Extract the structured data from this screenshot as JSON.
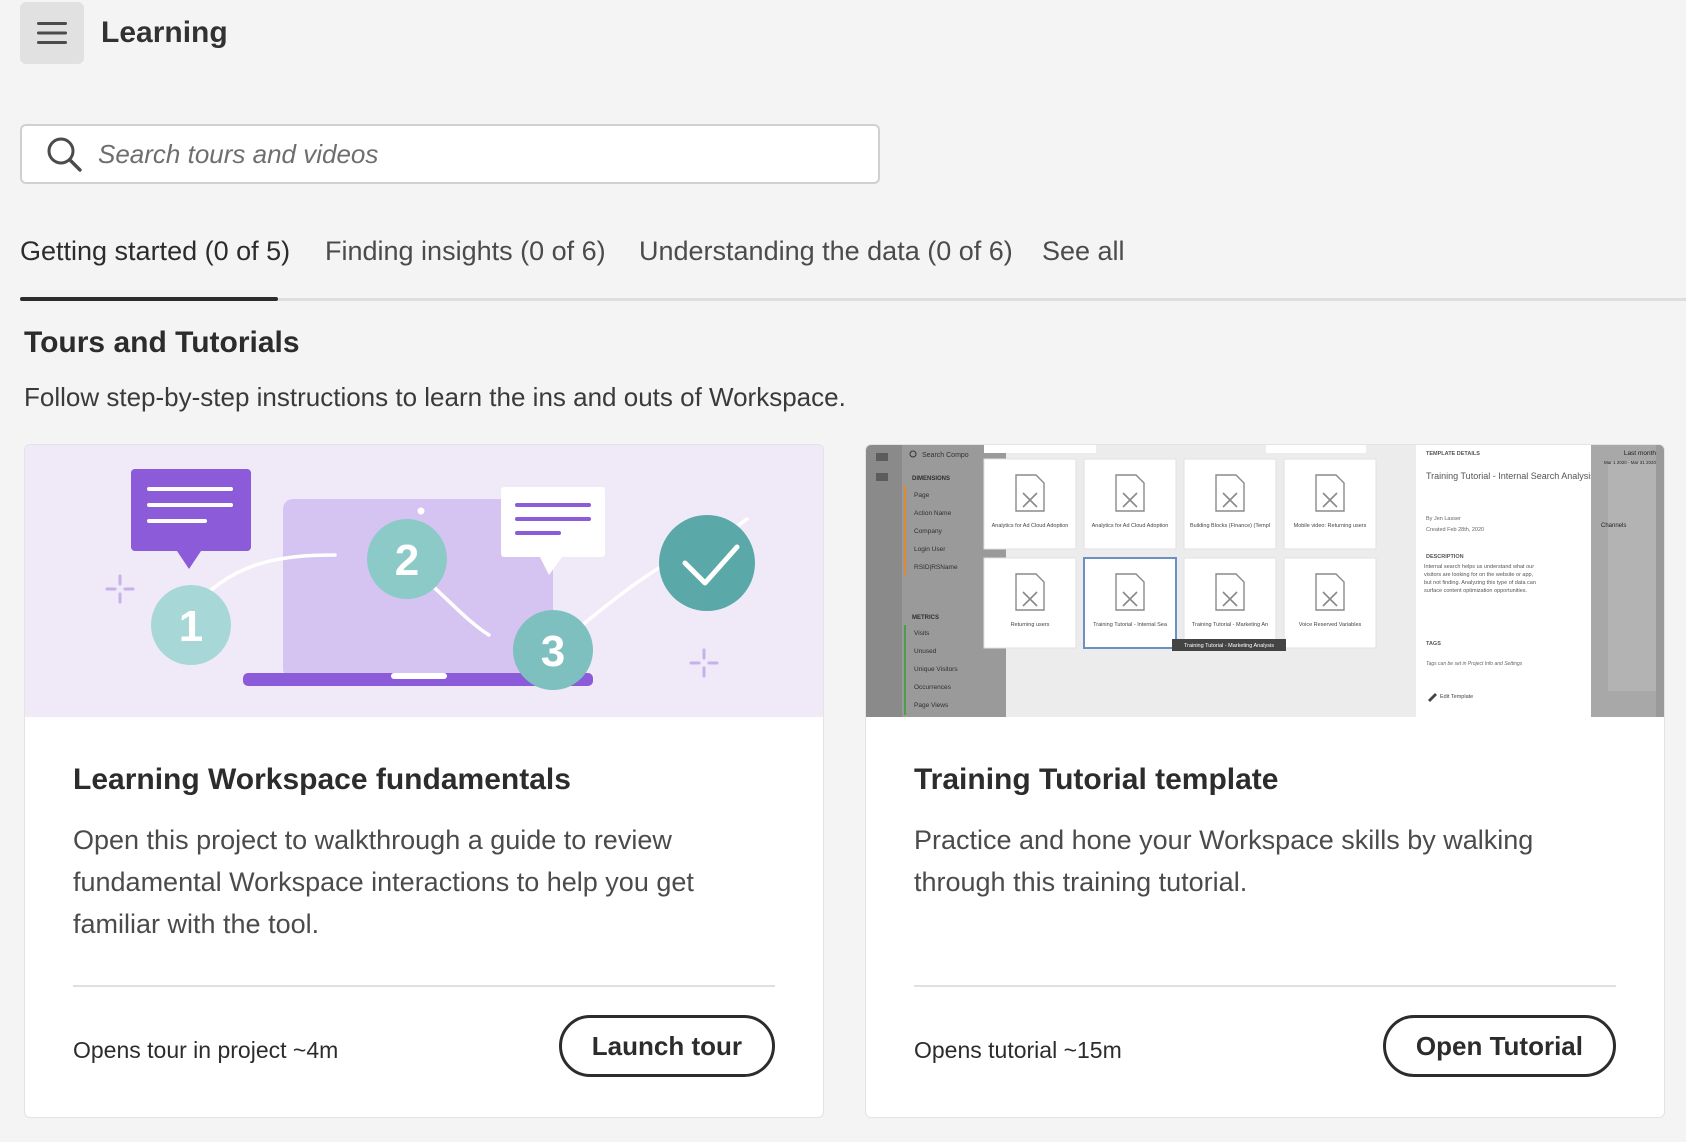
{
  "header": {
    "title": "Learning",
    "menu_icon": "hamburger-menu-icon"
  },
  "search": {
    "placeholder": "Search tours and videos",
    "value": "",
    "icon": "search-icon"
  },
  "tabs": [
    {
      "label": "Getting started (0 of 5)",
      "active": true
    },
    {
      "label": "Finding insights (0 of 6)",
      "active": false
    },
    {
      "label": "Understanding the data (0 of 6)",
      "active": false
    },
    {
      "label": "See all",
      "active": false
    }
  ],
  "section": {
    "title": "Tours and Tutorials",
    "description": "Follow step-by-step instructions to learn the ins and outs of Workspace."
  },
  "cards": [
    {
      "title": "Learning Workspace fundamentals",
      "description": "Open this project to walkthrough a guide to review fundamental Workspace interactions to help you get familiar with the tool.",
      "meta": "Opens tour in project ~4m",
      "button": "Launch tour",
      "illustration": {
        "steps": [
          "1",
          "2",
          "3"
        ],
        "bg": "#efe9f8",
        "accent": "#8b5bd9",
        "teal": "#8ccac8",
        "check": "#5aa9a8"
      }
    },
    {
      "title": "Training Tutorial template",
      "description": "Practice and hone your Workspace skills by walking through this training tutorial.",
      "meta": "Opens tutorial ~15m",
      "button": "Open Tutorial",
      "screenshot": {
        "search_placeholder": "Search Compo",
        "dimensions_heading": "DIMENSIONS",
        "dimensions": [
          "Page",
          "Action Name",
          "Company",
          "Login User",
          "RSID|RSName"
        ],
        "metrics_heading": "METRICS",
        "metrics": [
          "Visits",
          "Unused",
          "Unique Visitors",
          "Occurrences",
          "Page Views"
        ],
        "templates": [
          "Analytics for Ad Cloud Adoption Dashboard...",
          "Analytics for Ad Cloud Adoption Dashboard...",
          "Building Blocks (Finance) (Template)",
          "Mobile video: Returning users",
          "Returning users",
          "Training Tutorial - Internal Search Analysis",
          "Training Tutorial - Marketing Analysis",
          "Voice Reserved Variables"
        ],
        "tooltip": "Training Tutorial - Marketing Analysis",
        "details_heading": "TEMPLATE DETAILS",
        "details_title": "Training Tutorial - Internal Search Analysis",
        "details_author": "By Jen Lasser",
        "details_created": "Created Feb 28th, 2020",
        "description_heading": "DESCRIPTION",
        "description_text": "Internal search helps us understand what our visitors are looking for on the website or app, but not finding. Analyzing this type of data can surface content optimization opportunities.",
        "tags_heading": "TAGS",
        "tags_text": "Tags can be set in Project Info and Settings",
        "edit_label": "Edit Template",
        "date_label": "Last month",
        "date_range": "Mar 1 2020 - Mar 31 2020",
        "right_label": "Channels"
      }
    }
  ],
  "colors": {
    "background": "#f4f4f4",
    "text": "#2c2c2c",
    "border": "#d0d0d0"
  }
}
